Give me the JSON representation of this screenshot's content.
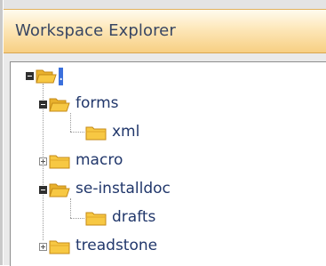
{
  "panel": {
    "title": "Workspace Explorer"
  },
  "tree": {
    "root": {
      "label": ".",
      "state": "expanded",
      "icon": "folder-open-icon"
    },
    "nodes": [
      {
        "label": "forms",
        "state": "expanded",
        "icon": "folder-open-icon",
        "level": 1
      },
      {
        "label": "xml",
        "state": "leaf",
        "icon": "folder-icon",
        "level": 2
      },
      {
        "label": "macro",
        "state": "collapsed",
        "icon": "folder-icon",
        "level": 1
      },
      {
        "label": "se-installdoc",
        "state": "expanded",
        "icon": "folder-open-icon",
        "level": 1
      },
      {
        "label": "drafts",
        "state": "leaf",
        "icon": "folder-icon",
        "level": 2
      },
      {
        "label": "treadstone",
        "state": "collapsed",
        "icon": "folder-icon",
        "level": 1
      }
    ]
  },
  "colors": {
    "header_top": "#fffbee",
    "header_bottom": "#f7cf83",
    "title_text": "#384663",
    "label_text": "#21376b",
    "folder_fill": "#f7c843",
    "selection": "#3a6fdc"
  }
}
